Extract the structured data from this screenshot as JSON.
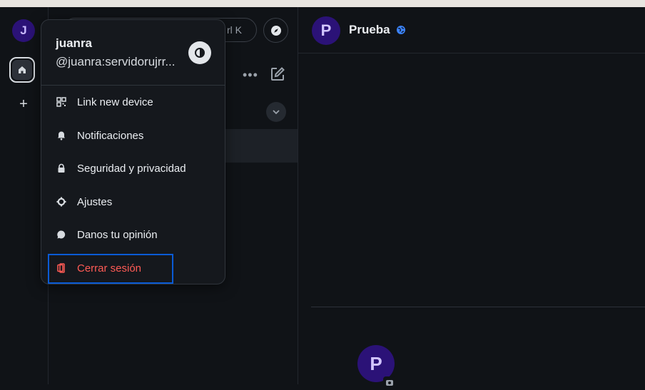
{
  "user": {
    "initial": "J",
    "display_name": "juanra",
    "user_id": "@juanra:servidorujrr..."
  },
  "spaces": {
    "home_label": "Home",
    "add_label": "+"
  },
  "search": {
    "shortcut_hint": "rl K"
  },
  "room": {
    "initial": "P",
    "name": "Prueba"
  },
  "menu": {
    "items": [
      {
        "label": "Link new device",
        "icon": "qr-code-icon"
      },
      {
        "label": "Notificaciones",
        "icon": "bell-icon"
      },
      {
        "label": "Seguridad y privacidad",
        "icon": "lock-icon"
      },
      {
        "label": "Ajustes",
        "icon": "gear-icon"
      },
      {
        "label": "Danos tu opinión",
        "icon": "chat-bubble-icon"
      },
      {
        "label": "Cerrar sesión",
        "icon": "sign-out-icon"
      }
    ]
  },
  "colors": {
    "accent_avatar": "#2b1277",
    "danger": "#ff5b55",
    "focus": "#0a5bd6"
  }
}
